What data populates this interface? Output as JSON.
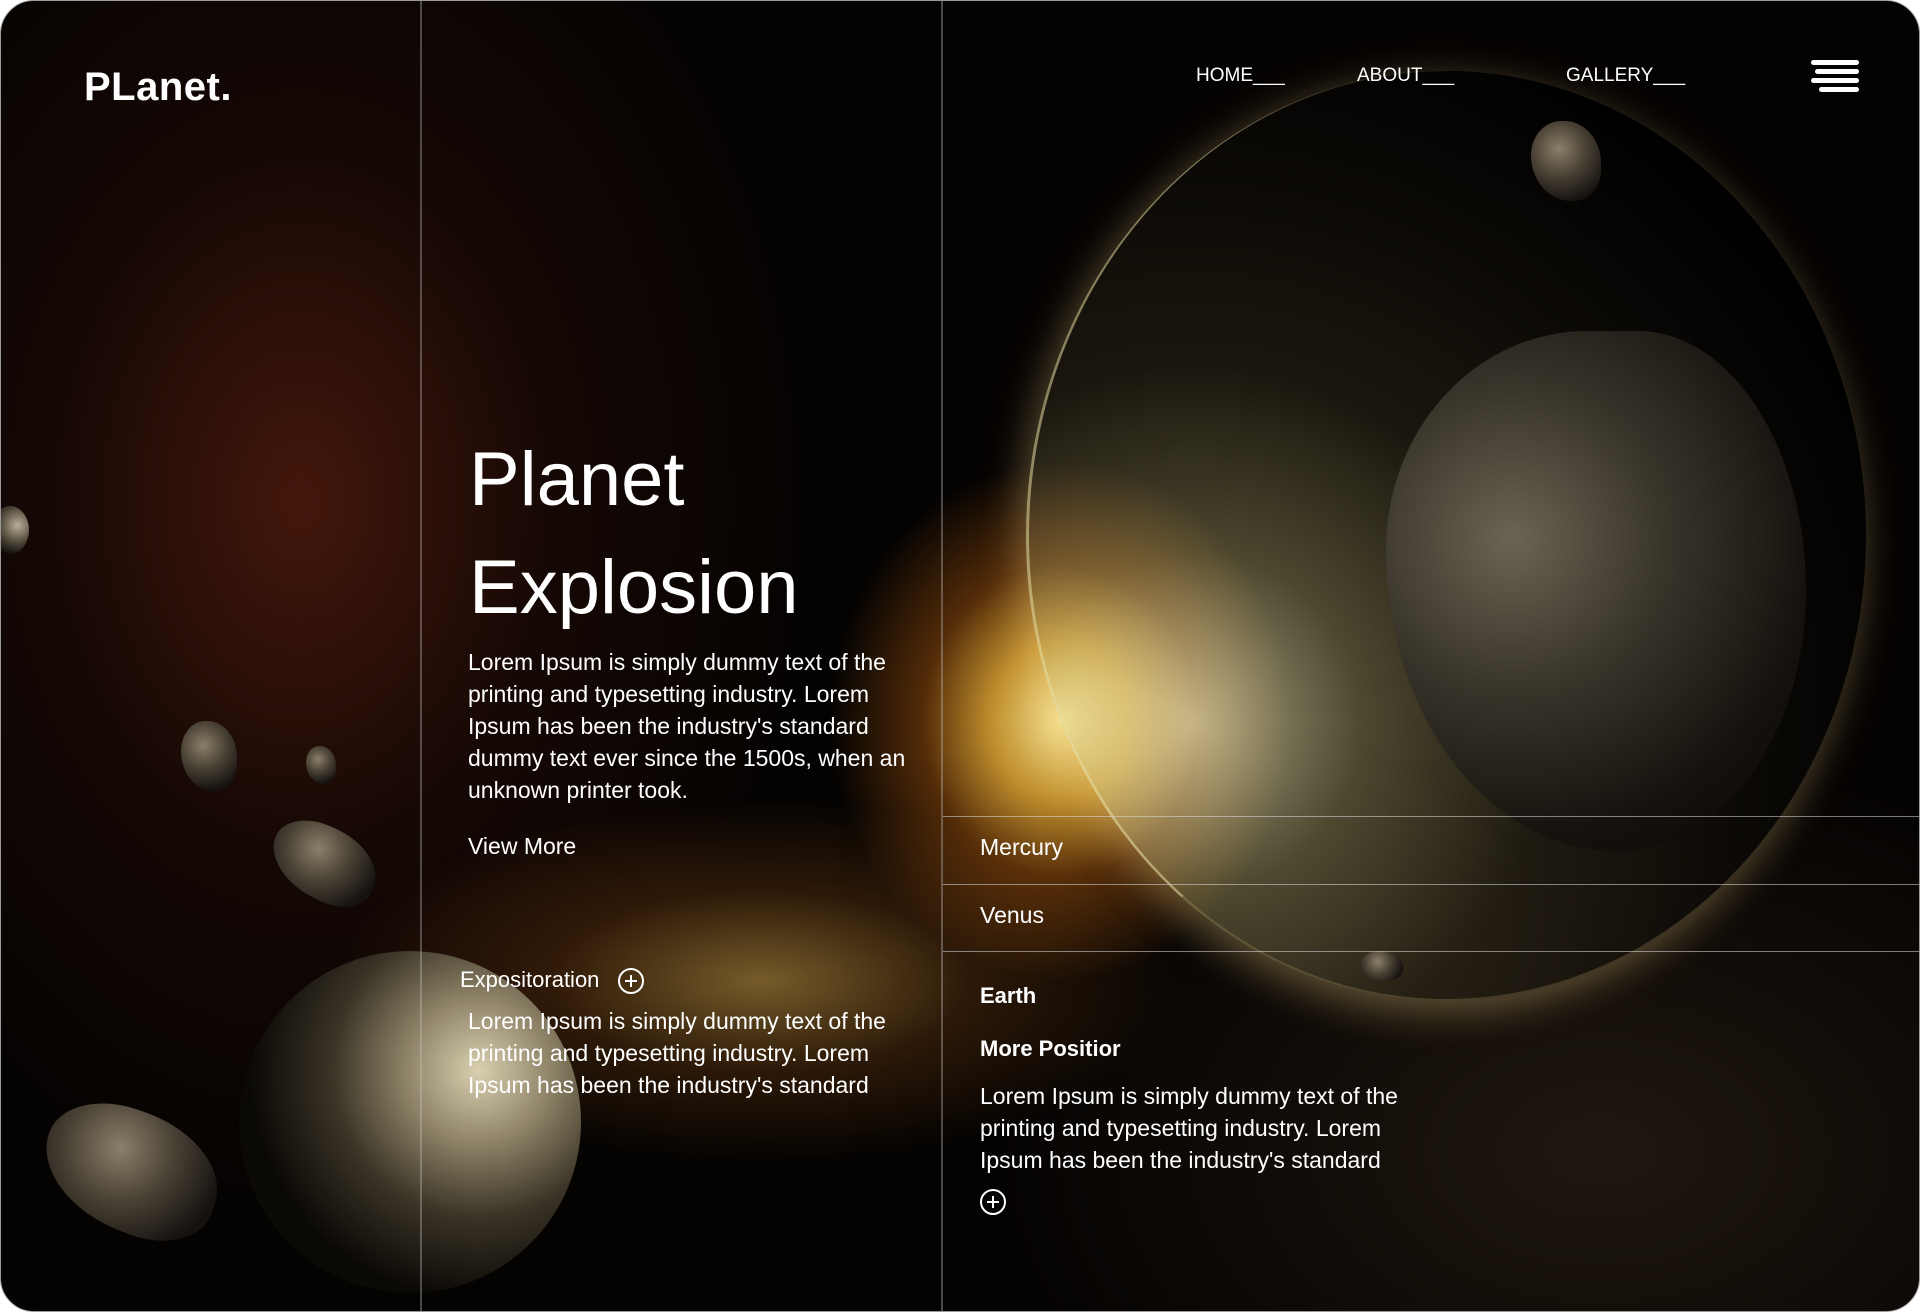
{
  "brand": {
    "logo": "PLanet."
  },
  "nav": {
    "items": [
      {
        "label": "HOME___"
      },
      {
        "label": "ABOUT___"
      },
      {
        "label": "GALLERY___"
      }
    ],
    "menu_icon": "hamburger-menu-icon"
  },
  "hero": {
    "title_line1": "Planet",
    "title_line2": "Explosion",
    "description": "Lorem Ipsum is simply dummy text of the printing and typesetting industry. Lorem Ipsum has been the industry's standard dummy text ever since the 1500s, when an unknown printer took.",
    "cta": "View More"
  },
  "exposition": {
    "label": "Expositoration",
    "icon": "plus-circle-icon",
    "text": "Lorem Ipsum is simply dummy text of the printing and typesetting industry. Lorem Ipsum has been the industry's standard"
  },
  "planets": {
    "items": [
      {
        "label": "Mercury"
      },
      {
        "label": "Venus"
      }
    ],
    "active": {
      "name": "Earth",
      "subtitle": "More Positior",
      "text": "Lorem Ipsum is simply dummy text of the printing and typesetting industry. Lorem Ipsum has been the industry's standard",
      "icon": "plus-circle-icon"
    }
  },
  "colors": {
    "text": "#ffffff",
    "background": "#050302",
    "glow": "#ffd36a"
  }
}
